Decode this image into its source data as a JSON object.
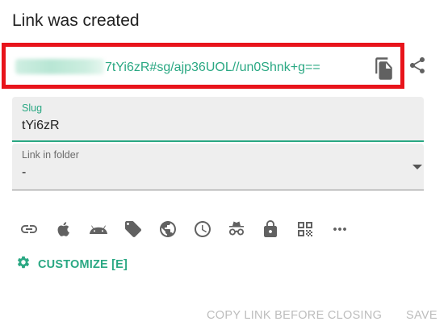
{
  "dialog": {
    "title": "Link was created"
  },
  "link": {
    "visible_text": "7tYi6zR#sg/ajp36UOL//un0Shnk+g=="
  },
  "slug": {
    "label": "Slug",
    "value": "tYi6zR"
  },
  "folder": {
    "label": "Link in folder",
    "value": "-"
  },
  "icons": [
    {
      "name": "link-icon"
    },
    {
      "name": "apple-icon"
    },
    {
      "name": "android-icon"
    },
    {
      "name": "tag-icon"
    },
    {
      "name": "globe-icon"
    },
    {
      "name": "clock-icon"
    },
    {
      "name": "incognito-icon"
    },
    {
      "name": "lock-icon"
    },
    {
      "name": "qr-code-icon"
    },
    {
      "name": "more-icon"
    }
  ],
  "customize": {
    "label": "CUSTOMIZE [E]"
  },
  "actions": {
    "copy_label": "COPY LINK BEFORE CLOSING",
    "save_label": "SAVE"
  },
  "colors": {
    "accent": "#2aa883",
    "highlight_border": "#e8141b",
    "icon": "#616161",
    "disabled_text": "#bdbdbd"
  }
}
